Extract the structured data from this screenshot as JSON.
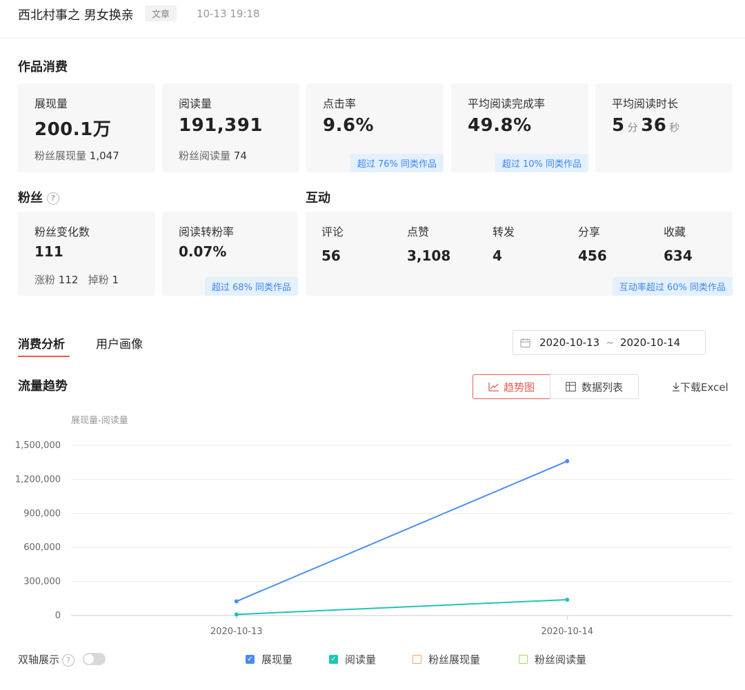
{
  "header": {
    "title": "西北村事之 男女换亲",
    "tag": "文章",
    "time": "10-13 19:18"
  },
  "consumption": {
    "title": "作品消费",
    "cards": [
      {
        "label": "展现量",
        "value": "200.1万",
        "sub_label": "粉丝展现量",
        "sub_value": "1,047"
      },
      {
        "label": "阅读量",
        "value": "191,391",
        "sub_label": "粉丝阅读量",
        "sub_value": "74"
      },
      {
        "label": "点击率",
        "value": "9.6%",
        "badge": "超过 76% 同类作品"
      },
      {
        "label": "平均阅读完成率",
        "value": "49.8%",
        "badge": "超过 10% 同类作品"
      },
      {
        "label": "平均阅读时长",
        "minutes": "5",
        "min_unit": "分",
        "seconds": "36",
        "sec_unit": "秒"
      }
    ]
  },
  "fans": {
    "title": "粉丝",
    "help_icon": "question-circle-icon",
    "change_card": {
      "label": "粉丝变化数",
      "value": "111",
      "gain_label": "涨粉",
      "gain_value": "112",
      "loss_label": "掉粉",
      "loss_value": "1"
    },
    "conversion_card": {
      "label": "阅读转粉率",
      "value": "0.07%",
      "badge": "超过 68% 同类作品"
    }
  },
  "interaction": {
    "title": "互动",
    "items": [
      {
        "label": "评论",
        "value": "56"
      },
      {
        "label": "点赞",
        "value": "3,108"
      },
      {
        "label": "转发",
        "value": "4"
      },
      {
        "label": "分享",
        "value": "456"
      },
      {
        "label": "收藏",
        "value": "634"
      }
    ],
    "badge": "互动率超过 60% 同类作品"
  },
  "tabs": [
    {
      "label": "消费分析",
      "active": true
    },
    {
      "label": "用户画像",
      "active": false
    }
  ],
  "date_range": {
    "start": "2020-10-13",
    "separator": "~",
    "end": "2020-10-14",
    "icon": "calendar-icon"
  },
  "trend": {
    "title": "流量趋势",
    "view_trend": "趋势图",
    "view_table": "数据列表",
    "download": "下载Excel"
  },
  "dual_axis": {
    "label": "双轴展示",
    "enabled": false
  },
  "colors": {
    "accent": "#e85a4f",
    "series_impressions": "#4a8cf0",
    "series_reads": "#1fc4b5",
    "series_fan_impressions": "#f4a36b",
    "series_fan_reads": "#a3d65c"
  },
  "chart_data": {
    "type": "line",
    "title": "展现量-阅读量",
    "x": [
      "2020-10-13",
      "2020-10-14"
    ],
    "yticks": [
      "0",
      "300,000",
      "600,000",
      "900,000",
      "1,200,000",
      "1,500,000"
    ],
    "ylim": [
      0,
      1500000
    ],
    "grid": true,
    "series": [
      {
        "name": "展现量",
        "values": [
          125000,
          1360000
        ],
        "checked": true,
        "color": "#4a8cf0"
      },
      {
        "name": "阅读量",
        "values": [
          10000,
          140000
        ],
        "checked": true,
        "color": "#1fc4b5"
      },
      {
        "name": "粉丝展现量",
        "values": [],
        "checked": false,
        "color": "#f4a36b"
      },
      {
        "name": "粉丝阅读量",
        "values": [],
        "checked": false,
        "color": "#a3d65c"
      }
    ],
    "legend_position": "bottom"
  }
}
